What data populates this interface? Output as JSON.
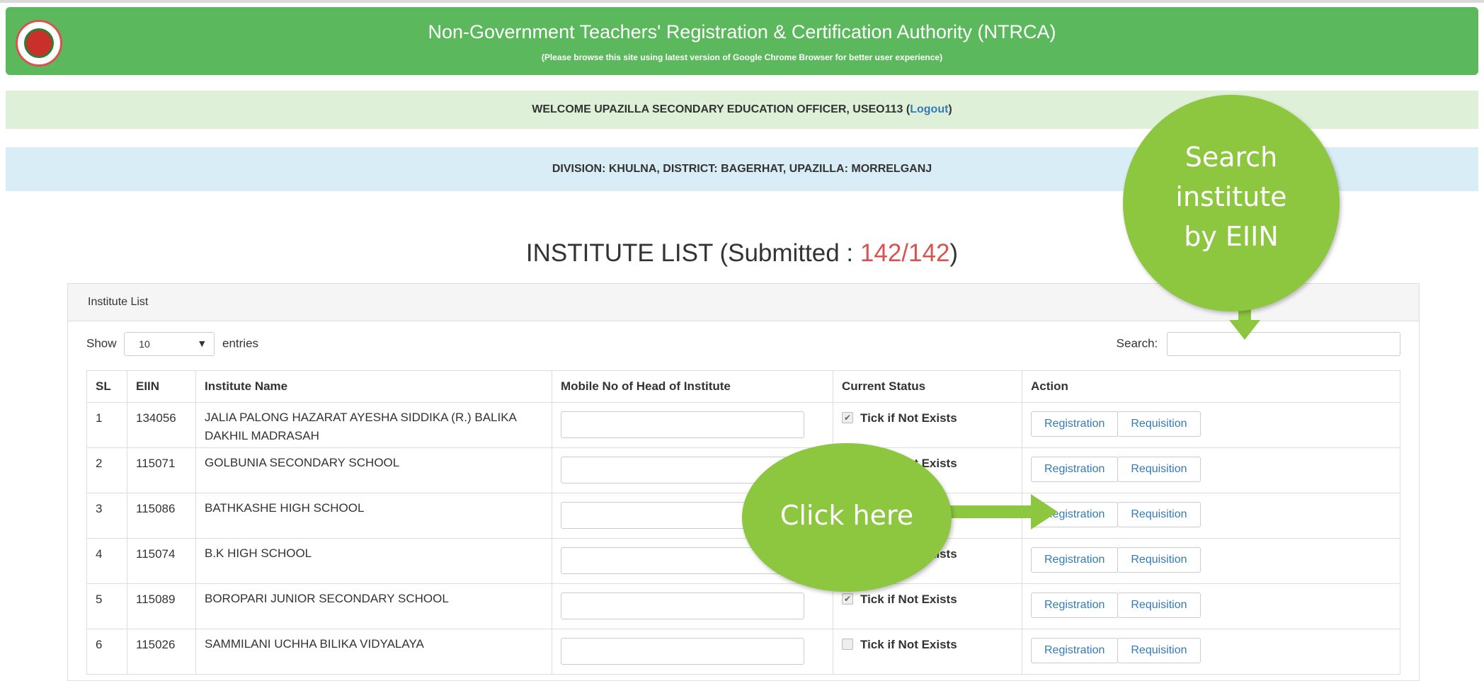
{
  "header": {
    "title": "Non-Government Teachers' Registration & Certification Authority (NTRCA)",
    "subtitle": "(Please browse this site using latest version of Google Chrome Browser for better user experience)"
  },
  "welcome": {
    "text": "WELCOME UPAZILLA SECONDARY EDUCATION OFFICER, USEO113 (",
    "logout": "Logout",
    "close": ")"
  },
  "division": "DIVISION: KHULNA, DISTRICT: BAGERHAT, UPAZILLA: MORRELGANJ",
  "page_title": {
    "prefix": "INSTITUTE LIST (Submitted : ",
    "count": "142/142",
    "suffix": ")"
  },
  "panel": {
    "heading": "Institute List",
    "show_label": "Show",
    "entries_value": "10",
    "entries_label": "entries",
    "search_label": "Search:"
  },
  "table": {
    "headers": [
      "SL",
      "EIIN",
      "Institute Name",
      "Mobile No of Head of Institute",
      "Current Status",
      "Action"
    ],
    "status_label": "Tick if Not Exists",
    "registration_label": "Registration",
    "requisition_label": "Requisition",
    "rows": [
      {
        "sl": "1",
        "eiin": "134056",
        "name": "JALIA PALONG HAZARAT AYESHA SIDDIKA (R.) BALIKA DAKHIL MADRASAH",
        "checked": true
      },
      {
        "sl": "2",
        "eiin": "115071",
        "name": "GOLBUNIA SECONDARY SCHOOL",
        "checked": true
      },
      {
        "sl": "3",
        "eiin": "115086",
        "name": "BATHKASHE HIGH SCHOOL",
        "checked": true
      },
      {
        "sl": "4",
        "eiin": "115074",
        "name": "B.K HIGH SCHOOL",
        "checked": true
      },
      {
        "sl": "5",
        "eiin": "115089",
        "name": "BOROPARI JUNIOR SECONDARY SCHOOL",
        "checked": true
      },
      {
        "sl": "6",
        "eiin": "115026",
        "name": "SAMMILANI UCHHA BILIKA VIDYALAYA",
        "checked": false
      }
    ]
  },
  "callouts": {
    "search_line1": "Search",
    "search_line2": "institute",
    "search_line3": "by EIIN",
    "click": "Click here"
  },
  "colors": {
    "header_green": "#5cb85c",
    "callout_green": "#8dc63f",
    "count_red": "#d9534f",
    "link_blue": "#337ab7"
  }
}
